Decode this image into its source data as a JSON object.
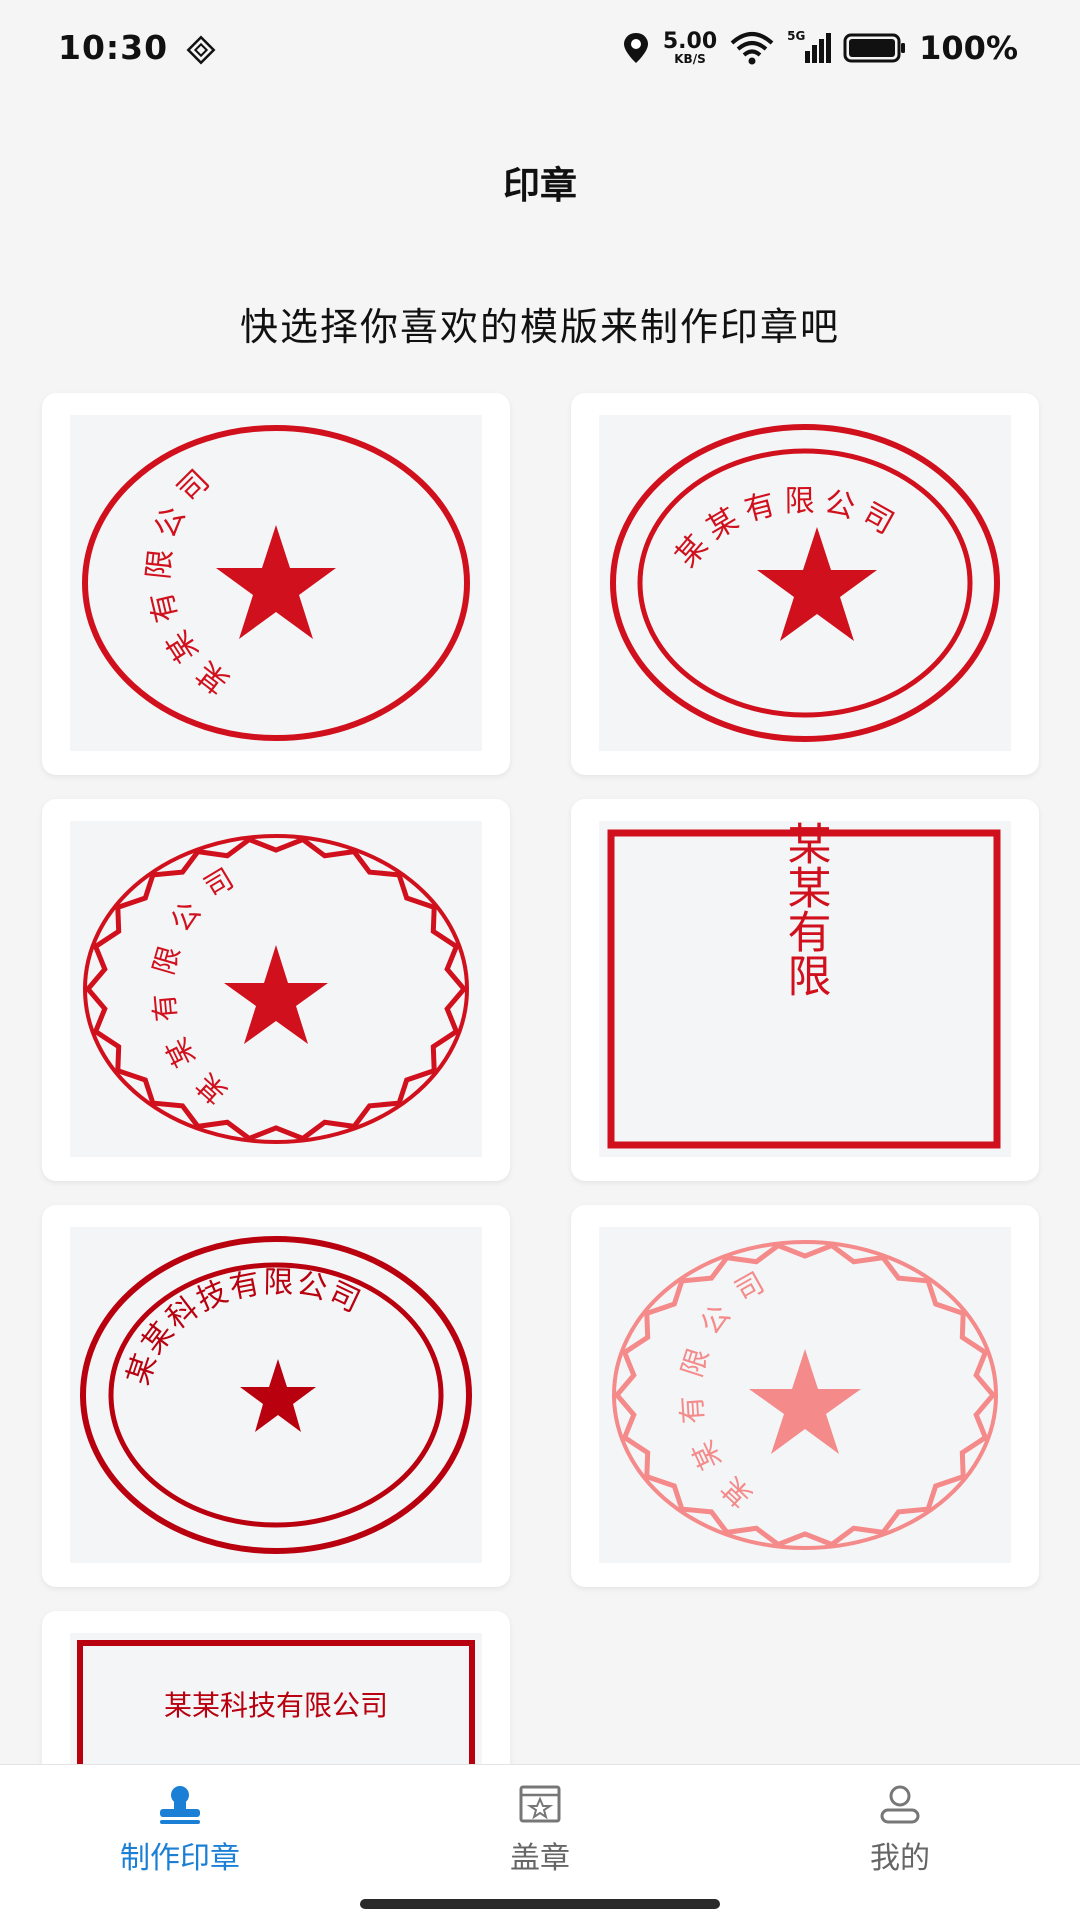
{
  "status_bar": {
    "time": "10:30",
    "net_speed_value": "5.00",
    "net_speed_unit": "KB/S",
    "signal_label": "5G",
    "battery": "100%"
  },
  "page": {
    "title": "印章",
    "subtitle": "快选择你喜欢的模版来制作印章吧"
  },
  "templates": {
    "t1_text": "某某有限公司",
    "t2_text": "某某有限公司",
    "t3_text": "某某有限公司",
    "t4_text": "某某有限",
    "t5_text": "某某科技有限公司",
    "t6_text": "某某有限公司",
    "t7_text": "某某科技有限公司"
  },
  "colors": {
    "stamp_red": "#d0101c",
    "stamp_dark_red": "#b8000e",
    "stamp_pink": "#f48a8a",
    "accent_blue": "#1c7fd6"
  },
  "tab_bar": {
    "tabs": [
      {
        "label": "制作印章",
        "icon": "stamp-icon",
        "active": true
      },
      {
        "label": "盖章",
        "icon": "seal-frame-icon",
        "active": false
      },
      {
        "label": "我的",
        "icon": "user-icon",
        "active": false
      }
    ]
  }
}
